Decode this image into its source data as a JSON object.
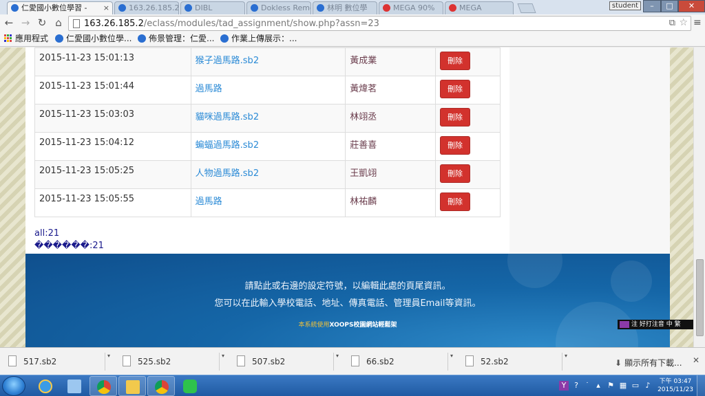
{
  "browser": {
    "tabs": [
      {
        "label": "仁愛國小數位學習 -",
        "active": true
      },
      {
        "label": "163.26.185.2",
        "active": false
      },
      {
        "label": "DIBL",
        "active": false
      },
      {
        "label": "Dokless Reme",
        "active": false
      },
      {
        "label": "林明 數位學",
        "active": false
      },
      {
        "label": "MEGA 90%",
        "active": false
      },
      {
        "label": "MEGA",
        "active": false
      }
    ],
    "user_badge": "student",
    "window_controls": {
      "minimize": "–",
      "maximize": "□",
      "close": "✕"
    },
    "url_host": "163.26.185.2",
    "url_path": "/eclass/modules/tad_assignment/show.php?assn=23",
    "bookmarks": [
      "應用程式",
      "仁愛國小數位學...",
      "佈景管理：仁愛...",
      "作業上傳展示：..."
    ]
  },
  "assignments": {
    "rows": [
      {
        "time": "2015-11-23 15:01:13",
        "file": "猴子過馬路.sb2",
        "student": "黃成業",
        "action": "刪除"
      },
      {
        "time": "2015-11-23 15:01:44",
        "file": "過馬路",
        "student": "黃煒茗",
        "action": "刪除"
      },
      {
        "time": "2015-11-23 15:03:03",
        "file": "貓咪過馬路.sb2",
        "student": "林翊丞",
        "action": "刪除"
      },
      {
        "time": "2015-11-23 15:04:12",
        "file": "蝙蝠過馬路.sb2",
        "student": "莊善喜",
        "action": "刪除"
      },
      {
        "time": "2015-11-23 15:05:25",
        "file": "人物過馬路.sb2",
        "student": "王凱翊",
        "action": "刪除"
      },
      {
        "time": "2015-11-23 15:05:55",
        "file": "過馬路",
        "student": "林祐麟",
        "action": "刪除"
      }
    ],
    "summary_all": "all:21",
    "summary_garbled": "������:21"
  },
  "footer": {
    "line1": "請點此或右邊的設定符號，以編輯此處的頁尾資訊。",
    "line2": "您可以在此輸入學校電話、地址、傳真電話、管理員Email等資訊。",
    "credit_prefix": "本系統使用",
    "credit_brand": "XOOPS校園網站輕鬆架"
  },
  "ime_bar": "注 好打注音  中 繁",
  "downloads": {
    "items": [
      "517.sb2",
      "525.sb2",
      "507.sb2",
      "66.sb2",
      "52.sb2"
    ],
    "show_all": "顯示所有下載...",
    "close": "✕"
  },
  "taskbar": {
    "time": "下午 03:47",
    "date": "2015/11/23"
  },
  "colors": {
    "delete_button": "#d2322d",
    "link": "#2a8ad6",
    "footer_blue": "#1566a7"
  }
}
